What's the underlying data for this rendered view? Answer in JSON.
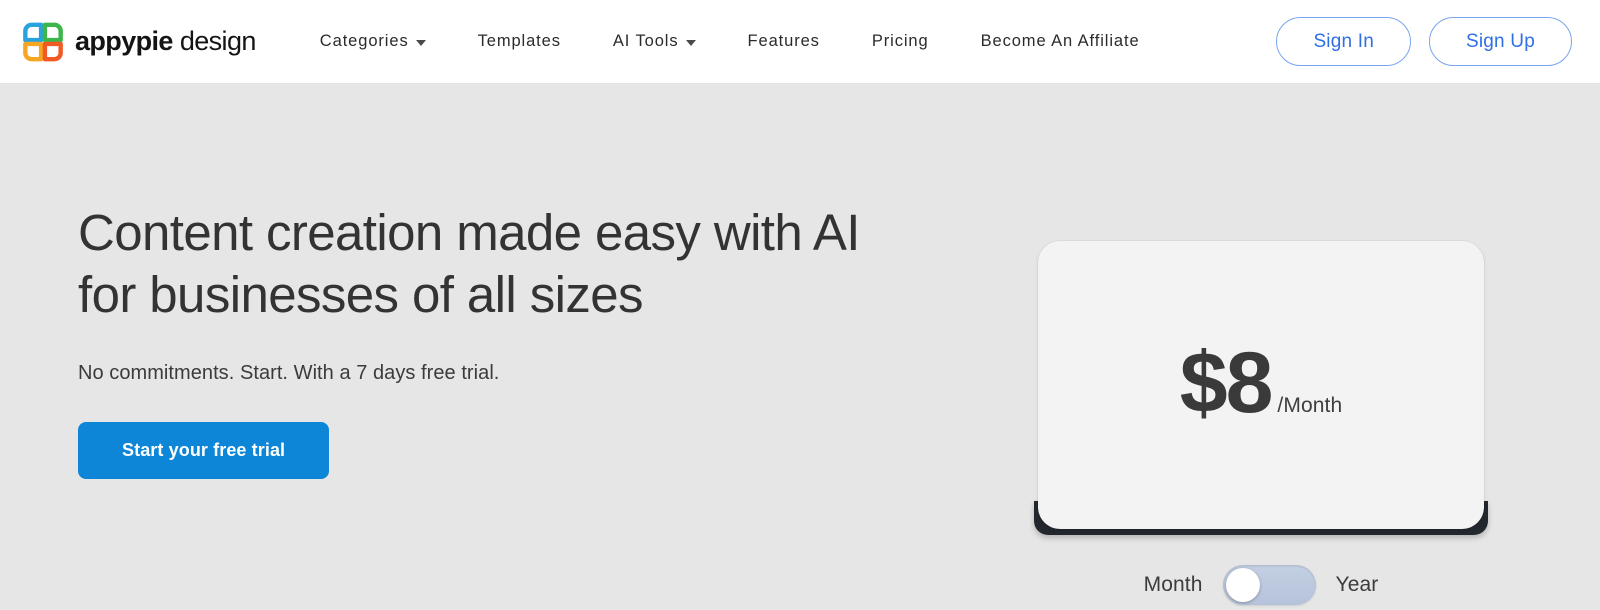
{
  "header": {
    "brand": {
      "name_bold": "appypie",
      "name_light": "design",
      "logo_icon": "appypie-pinwheel-logo-icon",
      "colors": {
        "petal_top_left": "#29a3e0",
        "petal_top_right": "#3cb54a",
        "petal_bottom_left": "#f5a623",
        "petal_bottom_right": "#f15a24"
      }
    },
    "nav": [
      {
        "label": "Categories",
        "has_dropdown": true
      },
      {
        "label": "Templates",
        "has_dropdown": false
      },
      {
        "label": "AI Tools",
        "has_dropdown": true
      },
      {
        "label": "Features",
        "has_dropdown": false
      },
      {
        "label": "Pricing",
        "has_dropdown": false
      },
      {
        "label": "Become An Affiliate",
        "has_dropdown": false
      }
    ],
    "auth": {
      "sign_in": "Sign In",
      "sign_up": "Sign Up",
      "accent_color": "#2f6fe4"
    }
  },
  "hero": {
    "headline_line1": "Content creation made easy with AI",
    "headline_line2": "for businesses of all sizes",
    "subline": "No commitments. Start. With a 7 days free trial.",
    "cta_label": "Start your free trial",
    "cta_color": "#0d86d8",
    "background_color": "#e6e6e6"
  },
  "pricing": {
    "price_amount": "$8",
    "price_period": "/Month",
    "card_color": "#f3f3f3",
    "card_base_color": "#23272e",
    "billing": {
      "left_label": "Month",
      "right_label": "Year",
      "selected": "Month",
      "toggle_state": "off",
      "track_color": "#bcc8dd",
      "knob_color": "#ffffff"
    }
  }
}
